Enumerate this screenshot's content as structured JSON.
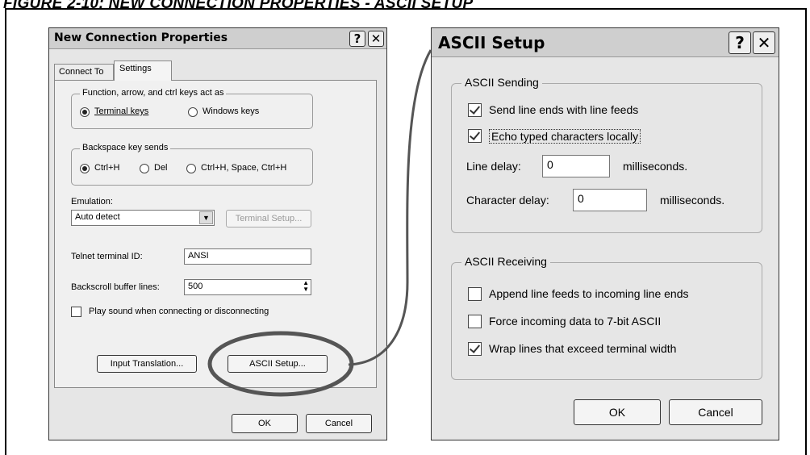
{
  "figure_caption": "FIGURE 2-10:         NEW CONNECTION PROPERTIES - ASCII SETUP",
  "left_dialog": {
    "title": "New Connection Properties",
    "help_glyph": "?",
    "close_glyph": "✕",
    "tabs": [
      "Connect To",
      "Settings"
    ],
    "keys_group": {
      "label": "Function, arrow, and ctrl keys act as",
      "options": [
        {
          "label": "Terminal keys",
          "selected": true
        },
        {
          "label": "Windows keys",
          "selected": false
        }
      ]
    },
    "backspace_group": {
      "label": "Backspace key sends",
      "options": [
        {
          "label": "Ctrl+H",
          "selected": true
        },
        {
          "label": "Del",
          "selected": false
        },
        {
          "label": "Ctrl+H, Space, Ctrl+H",
          "selected": false
        }
      ]
    },
    "emulation_label": "Emulation:",
    "emulation_value": "Auto detect",
    "terminal_setup_label": "Terminal Setup...",
    "telnet_label": "Telnet terminal ID:",
    "telnet_value": "ANSI",
    "backscroll_label": "Backscroll buffer lines:",
    "backscroll_value": "500",
    "play_sound_label": "Play sound when connecting or disconnecting",
    "play_sound_checked": false,
    "input_translation_label": "Input Translation...",
    "ascii_setup_label": "ASCII Setup...",
    "ok_label": "OK",
    "cancel_label": "Cancel"
  },
  "right_dialog": {
    "title": "ASCII Setup",
    "help_glyph": "?",
    "close_glyph": "✕",
    "sending": {
      "label": "ASCII Sending",
      "send_line_ends": {
        "label": "Send line ends with line feeds",
        "checked": true
      },
      "echo_typed": {
        "label": "Echo typed characters locally",
        "checked": true
      },
      "line_delay_label": "Line delay:",
      "line_delay_value": "0",
      "line_delay_unit": "milliseconds.",
      "char_delay_label": "Character delay:",
      "char_delay_value": "0",
      "char_delay_unit": "milliseconds."
    },
    "receiving": {
      "label": "ASCII Receiving",
      "append_line_feeds": {
        "label": "Append line feeds to incoming line ends",
        "checked": false
      },
      "force_7bit": {
        "label": "Force incoming data to 7-bit ASCII",
        "checked": false
      },
      "wrap_lines": {
        "label": "Wrap lines that exceed terminal width",
        "checked": true
      }
    },
    "ok_label": "OK",
    "cancel_label": "Cancel"
  }
}
